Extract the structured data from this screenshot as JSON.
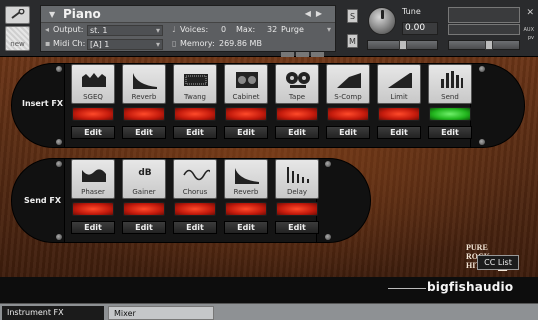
{
  "header": {
    "instrument_name": "Piano",
    "output_label": "Output:",
    "output_value": "st. 1",
    "midi_label": "Midi Ch:",
    "midi_value": "[A] 1",
    "voices_label": "Voices:",
    "voices_value": "0",
    "max_label": "Max:",
    "max_value": "32",
    "purge_label": "Purge",
    "memory_label": "Memory:",
    "memory_value": "269.86 MB",
    "solo_label": "S",
    "mute_label": "M",
    "tune_label": "Tune",
    "tune_value": "0.00",
    "aux_label": "AUX",
    "pv_label": "pv",
    "new_label": "new"
  },
  "insert_fx": {
    "label": "Insert FX",
    "edit_label": "Edit",
    "slots": [
      {
        "name": "SGEQ",
        "icon": "eq-bars-icon",
        "led": "red"
      },
      {
        "name": "Reverb",
        "icon": "reverb-decay-icon",
        "led": "red"
      },
      {
        "name": "Twang",
        "icon": "amp-grille-icon",
        "led": "red"
      },
      {
        "name": "Cabinet",
        "icon": "speaker-cabinet-icon",
        "led": "red"
      },
      {
        "name": "Tape",
        "icon": "tape-reels-icon",
        "led": "red"
      },
      {
        "name": "S-Comp",
        "icon": "compressor-curve-icon",
        "led": "red"
      },
      {
        "name": "Limit",
        "icon": "limiter-curve-icon",
        "led": "red"
      },
      {
        "name": "Send",
        "icon": "send-levels-icon",
        "led": "green"
      }
    ]
  },
  "send_fx": {
    "label": "Send FX",
    "edit_label": "Edit",
    "slots": [
      {
        "name": "Phaser",
        "icon": "phaser-wave-icon",
        "led": "red"
      },
      {
        "name": "Gainer",
        "icon": "gain-db-icon",
        "led": "red",
        "icon_text": "dB"
      },
      {
        "name": "Chorus",
        "icon": "chorus-wave-icon",
        "led": "red"
      },
      {
        "name": "Reverb",
        "icon": "reverb-decay-icon",
        "led": "red"
      },
      {
        "name": "Delay",
        "icon": "delay-taps-icon",
        "led": "red"
      }
    ]
  },
  "logos": {
    "product_line1": "PURE",
    "product_line2": "ROCK",
    "product_line3": "HITS",
    "product_number": "2",
    "brand": "bigfishaudio"
  },
  "cc_list_label": "CC List",
  "tabs": [
    {
      "label": "Instrument FX",
      "active": true
    },
    {
      "label": "Mixer",
      "active": false
    }
  ],
  "colors": {
    "led_red": "#d0220f",
    "led_green": "#2ec12a",
    "panel_wood": "#5a2c13"
  }
}
